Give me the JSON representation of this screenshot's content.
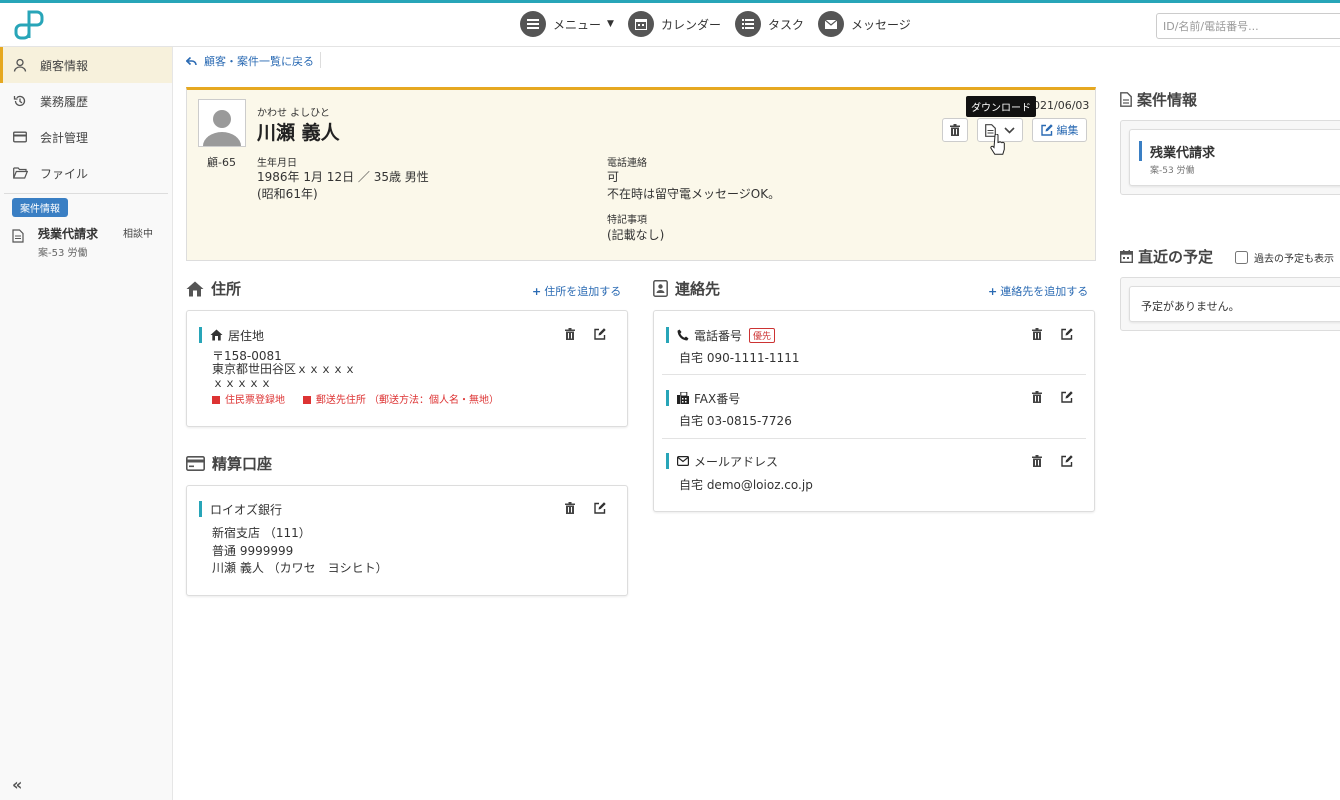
{
  "header": {
    "nav": {
      "menu": "メニュー",
      "calendar": "カレンダー",
      "task": "タスク",
      "message": "メッセージ"
    },
    "search_placeholder": "ID/名前/電話番号..."
  },
  "sidebar": {
    "items": [
      {
        "label": "顧客情報",
        "icon": "person-icon"
      },
      {
        "label": "業務履歴",
        "icon": "history-icon"
      },
      {
        "label": "会計管理",
        "icon": "card-icon"
      },
      {
        "label": "ファイル",
        "icon": "folder-icon"
      }
    ],
    "badge": "案件情報",
    "case": {
      "title": "残業代請求",
      "sub": "案-53 労働",
      "status": "相談中"
    }
  },
  "breadcrumb": {
    "back": "顧客・案件一覧に戻る"
  },
  "profile": {
    "kana": "かわせ よしひと",
    "name": "川瀬 義人",
    "id": "顧-65",
    "birth_label": "生年月日",
    "birth_value": "1986年 1月 12日 ／ 35歳 男性",
    "birth_era": "(昭和61年)",
    "phone_label": "電話連絡",
    "phone_value": "可",
    "phone_note": "不在時は留守電メッセージOK。",
    "notes_label": "特記事項",
    "notes_value": "(記載なし)",
    "date": "021/06/03",
    "tooltip": "ダウンロード",
    "edit": "編集"
  },
  "address": {
    "title": "住所",
    "add": "住所を追加する",
    "card_title": "居住地",
    "zip": "〒158-0081",
    "line1": "東京都世田谷区ｘｘｘｘｘ",
    "line2": "ｘｘｘｘｘ",
    "tag1": "住民票登録地",
    "tag2": "郵送先住所 （郵送方法：個人名・無地）"
  },
  "bank": {
    "title": "精算口座",
    "card_title": "ロイオズ銀行",
    "branch": "新宿支店 （111）",
    "account": "普通 9999999",
    "holder": "川瀬 義人 （カワセ　ヨシヒト）"
  },
  "contact": {
    "title": "連絡先",
    "add": "連絡先を追加する",
    "items": [
      {
        "label": "電話番号",
        "value": "自宅 090-1111-1111",
        "badge": "優先"
      },
      {
        "label": "FAX番号",
        "value": "自宅 03-0815-7726"
      },
      {
        "label": "メールアドレス",
        "value": "自宅 demo@loioz.co.jp"
      }
    ]
  },
  "right": {
    "case_title": "案件情報",
    "case_card_title": "残業代請求",
    "case_card_sub": "案-53 労働",
    "schedule_title": "直近の予定",
    "past_label": "過去の予定も表示",
    "empty": "予定がありません。"
  },
  "colors": {
    "accent": "#28a5b8",
    "link": "#2a6ab3",
    "gold": "#e6a820"
  }
}
